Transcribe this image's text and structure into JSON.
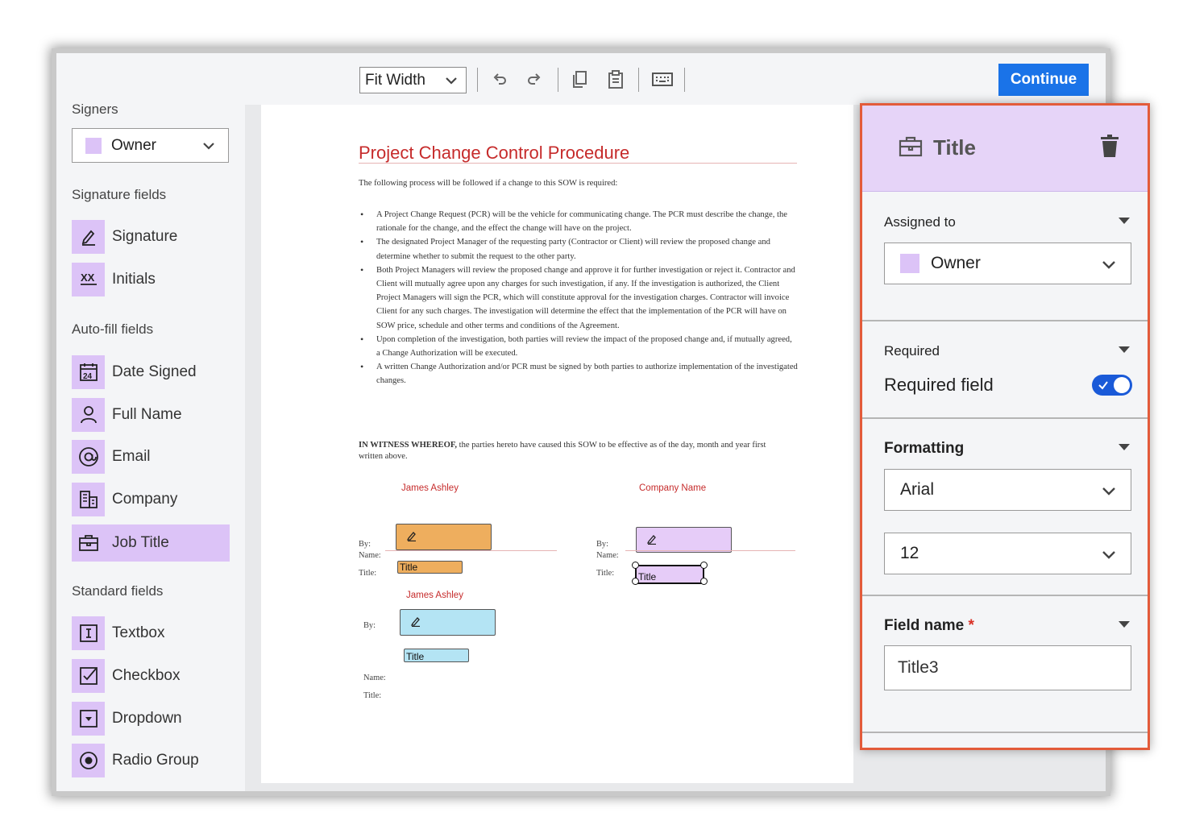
{
  "toolbar": {
    "zoom": "Fit Width",
    "continue_label": "Continue",
    "icons": [
      "undo-icon",
      "redo-icon",
      "copy-icon",
      "paste-icon",
      "keyboard-icon"
    ]
  },
  "sidebar": {
    "signers_heading": "Signers",
    "signer_selected": "Owner",
    "signature_heading": "Signature fields",
    "signature_items": [
      {
        "label": "Signature",
        "icon": "pen-icon"
      },
      {
        "label": "Initials",
        "icon": "initials-icon"
      }
    ],
    "autofill_heading": "Auto-fill fields",
    "autofill_items": [
      {
        "label": "Date Signed",
        "icon": "calendar-icon"
      },
      {
        "label": "Full Name",
        "icon": "person-icon"
      },
      {
        "label": "Email",
        "icon": "at-icon"
      },
      {
        "label": "Company",
        "icon": "building-icon"
      },
      {
        "label": "Job Title",
        "icon": "briefcase-icon"
      }
    ],
    "standard_heading": "Standard fields",
    "standard_items": [
      {
        "label": "Textbox",
        "icon": "textbox-icon"
      },
      {
        "label": "Checkbox",
        "icon": "checkbox-icon"
      },
      {
        "label": "Dropdown",
        "icon": "dropdown-icon"
      },
      {
        "label": "Radio Group",
        "icon": "radio-icon"
      }
    ]
  },
  "document": {
    "title": "Project Change Control Procedure",
    "intro": "The following process will be followed if a change to this SOW is required:",
    "bullets": [
      "A Project Change Request (PCR) will be the vehicle for communicating change. The PCR must describe the change, the rationale for the change, and the effect the change will have on the project.",
      "The designated Project Manager of the requesting party (Contractor or Client) will review the proposed change and determine whether to submit the request to the other party.",
      "Both Project Managers will review the proposed change and approve it for further investigation or reject it. Contractor and Client will mutually agree upon any charges for such investigation, if any. If the investigation is authorized, the Client Project Managers will sign the PCR, which will constitute approval for the investigation charges. Contractor will invoice Client for any such charges. The investigation will determine the effect that the implementation of the PCR will have on SOW price, schedule and other terms and conditions of the Agreement.",
      "Upon completion of the investigation, both parties will review the impact of the proposed change and, if mutually agreed, a Change Authorization will be executed.",
      "A written Change Authorization and/or PCR must be signed by both parties to authorize implementation of the investigated changes."
    ],
    "witness_bold": "IN WITNESS WHEREOF,",
    "witness_rest": " the parties hereto have caused this SOW to be effective as of the day, month and year first written above.",
    "signer1_name": "James Ashley",
    "signer2_name": "Company Name",
    "signer3_name": "James Ashley",
    "by_label": "By:",
    "name_label": "Name:",
    "title_label": "Title:",
    "field_title": "Title"
  },
  "panel": {
    "title": "Title",
    "assigned_label": "Assigned to",
    "assigned_value": "Owner",
    "required_label": "Required",
    "required_field_label": "Required field",
    "required_on": true,
    "formatting_label": "Formatting",
    "font_value": "Arial",
    "size_value": "12",
    "fieldname_label": "Field name",
    "fieldname_star": "*",
    "fieldname_value": "Title3"
  },
  "colors": {
    "accent": "#1a73e8",
    "signer_owner": "#dcc3f7",
    "signer_orange": "#eeae5e",
    "signer_blue": "#b4e4f4",
    "doc_title": "#c62b2b",
    "panel_border": "#e35b3a"
  }
}
